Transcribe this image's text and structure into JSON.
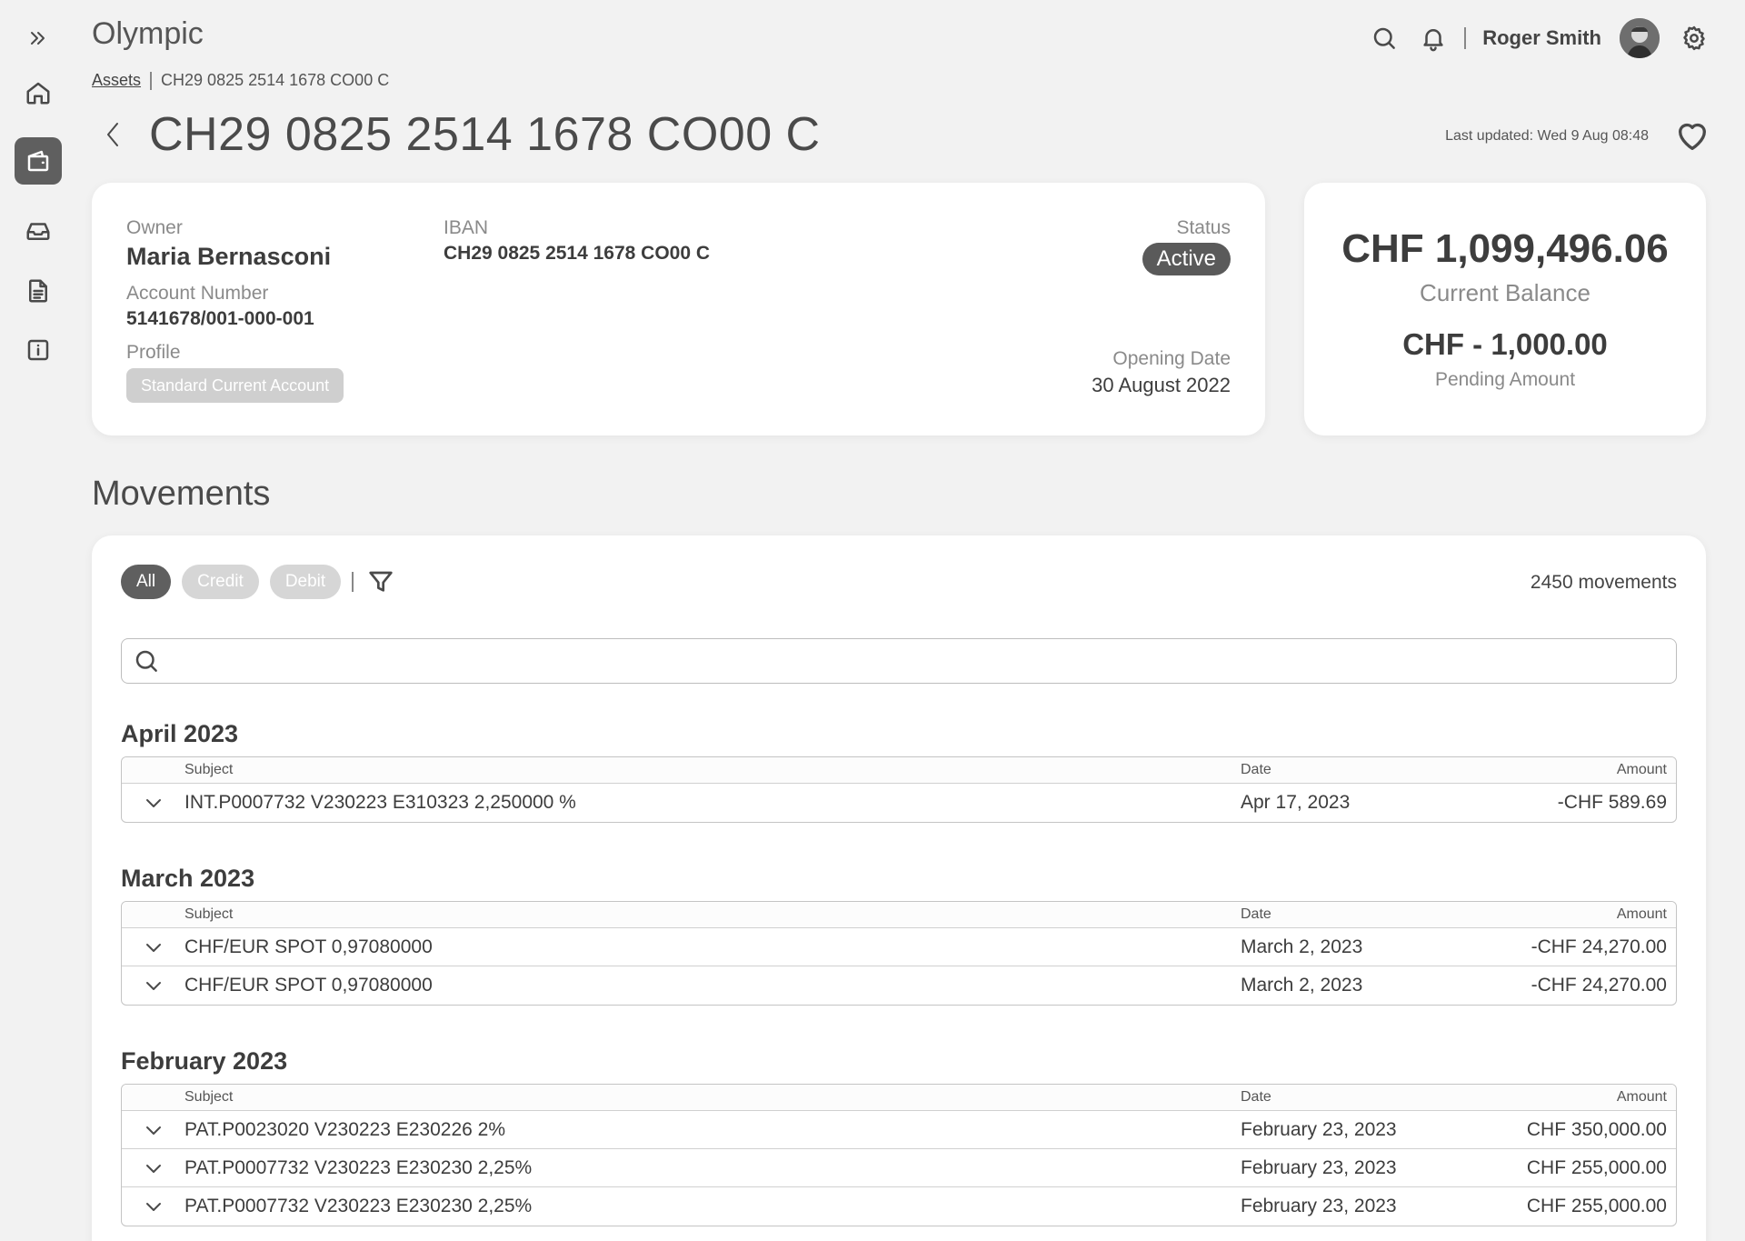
{
  "app": {
    "title": "Olympic"
  },
  "header": {
    "user_name": "Roger Smith"
  },
  "breadcrumb": {
    "root": "Assets",
    "current": "CH29 0825 2514 1678 CO00 C"
  },
  "page": {
    "title": "CH29 0825 2514 1678 CO00 C",
    "last_updated": "Last updated: Wed 9 Aug 08:48"
  },
  "account": {
    "owner_label": "Owner",
    "owner": "Maria Bernasconi",
    "account_number_label": "Account Number",
    "account_number": "5141678/001-000-001",
    "profile_label": "Profile",
    "profile": "Standard Current Account",
    "iban_label": "IBAN",
    "iban": "CH29 0825 2514 1678 CO00 C",
    "status_label": "Status",
    "status": "Active",
    "opening_date_label": "Opening Date",
    "opening_date": "30 August 2022"
  },
  "balance": {
    "current": "CHF 1,099,496.06",
    "current_label": "Current Balance",
    "pending": "CHF - 1,000.00",
    "pending_label": "Pending Amount"
  },
  "movements": {
    "title": "Movements",
    "filters": [
      "All",
      "Credit",
      "Debit"
    ],
    "count": "2450 movements",
    "search_placeholder": "",
    "columns": {
      "subject": "Subject",
      "date": "Date",
      "amount": "Amount"
    },
    "groups": [
      {
        "title": "April 2023",
        "rows": [
          {
            "subject": "INT.P0007732 V230223 E310323 2,250000 %",
            "date": "Apr 17, 2023",
            "amount": "-CHF 589.69"
          }
        ]
      },
      {
        "title": "March 2023",
        "rows": [
          {
            "subject": "CHF/EUR SPOT 0,97080000",
            "date": "March 2, 2023",
            "amount": "-CHF 24,270.00"
          },
          {
            "subject": "CHF/EUR SPOT 0,97080000",
            "date": "March 2, 2023",
            "amount": "-CHF 24,270.00"
          }
        ]
      },
      {
        "title": "February 2023",
        "rows": [
          {
            "subject": "PAT.P0023020 V230223 E230226 2%",
            "date": "February 23, 2023",
            "amount": "CHF 350,000.00"
          },
          {
            "subject": "PAT.P0007732 V230223 E230230 2,25%",
            "date": "February 23, 2023",
            "amount": "CHF 255,000.00"
          },
          {
            "subject": "PAT.P0007732 V230223 E230230 2,25%",
            "date": "February 23, 2023",
            "amount": "CHF 255,000.00"
          }
        ]
      }
    ]
  }
}
